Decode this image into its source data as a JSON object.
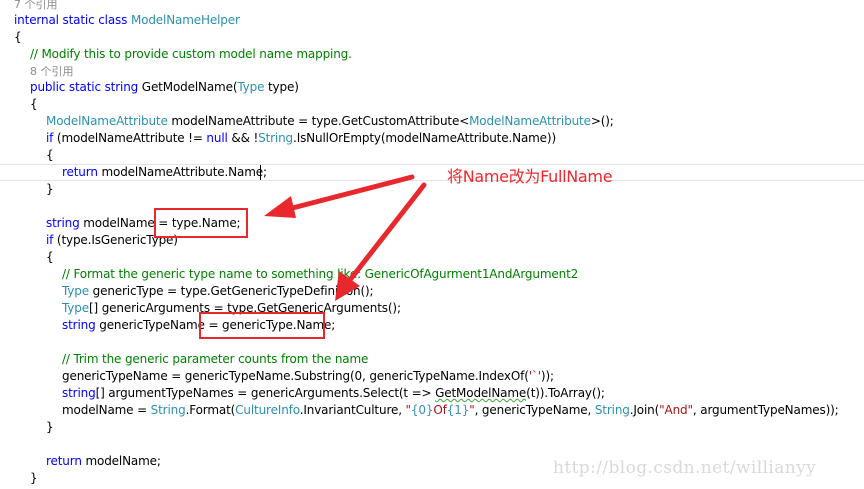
{
  "references": {
    "class_refs": "7 个引用",
    "method_refs": "8 个引用"
  },
  "code": {
    "class_decl": {
      "kw": "internal static class",
      "name": "ModelNameHelper"
    },
    "open_brace": "{",
    "comment_modify": "// Modify this to provide custom model name mapping.",
    "method_decl": {
      "kw": "public static string",
      "name": " GetModelName(",
      "param_type": "Type",
      "param": " type)"
    },
    "method_open": "{",
    "attr_line": {
      "type": "ModelNameAttribute",
      "mid": " modelNameAttribute = type.GetCustomAttribute<",
      "generic": "ModelNameAttribute",
      "end": ">();"
    },
    "if_attr": {
      "kw": "if",
      "a": " (modelNameAttribute != ",
      "null": "null",
      "b": " && !",
      "string": "String",
      "c": ".IsNullOrEmpty(modelNameAttribute.Name))"
    },
    "if_open": "{",
    "return_attr": {
      "kw": "return",
      "rest": " modelNameAttribute.Name;"
    },
    "if_close": "}",
    "model_name": {
      "kw": "string",
      "rest": " modelName = type.Name;"
    },
    "if_generic": {
      "kw": "if",
      "rest": " (type.IsGenericType)"
    },
    "generic_open": "{",
    "comment_format": "// Format the generic type name to something like: GenericOfAgurment1AndArgument2",
    "generic_type": {
      "type": "Type",
      "rest": " genericType = type.GetGenericTypeDefinition();"
    },
    "generic_args": {
      "type": "Type",
      "rest": "[] genericArguments = type.GetGenericArguments();"
    },
    "generic_type_name": {
      "kw": "string",
      "rest": " genericTypeName = genericType.Name;"
    },
    "comment_trim": "// Trim the generic parameter counts from the name",
    "substring_line": {
      "a": "genericTypeName = genericTypeName.Substring(0, genericTypeName.IndexOf(",
      "str": "'`'",
      "b": "));"
    },
    "arg_names_line": {
      "kw": "string",
      "a": "[] argumentTypeNames = genericArguments.Select(t => ",
      "squig": "GetModelName",
      "b": "(t)).ToArray();"
    },
    "format_line": {
      "a": "modelName = ",
      "string": "String",
      "b": ".Format(",
      "culture": "CultureInfo",
      "c": ".InvariantCulture, ",
      "q1": "\"",
      "f0": "{0}",
      "of": "Of",
      "f1": "{1}",
      "q2": "\"",
      "d": ", genericTypeName, ",
      "string2": "String",
      "e": ".Join(",
      "and": "\"And\"",
      "f": ", argumentTypeNames));"
    },
    "generic_close": "}",
    "return_model": {
      "kw": "return",
      "rest": " modelName;"
    },
    "method_close": "}"
  },
  "annotation": {
    "text": "将Name改为FullName",
    "color": "#f0282d"
  },
  "watermark": "http://blog.csdn.net/willianyy"
}
